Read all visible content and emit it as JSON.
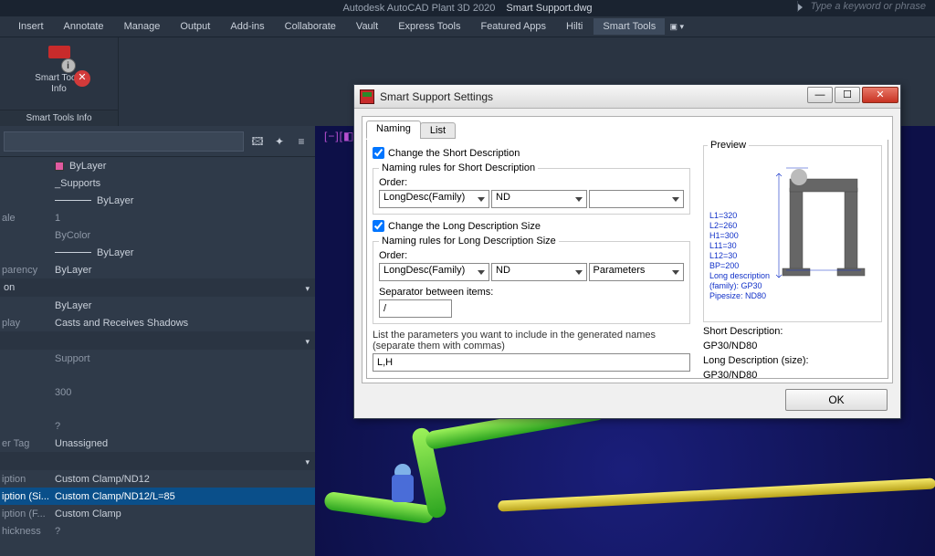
{
  "titlebar": {
    "app": "Autodesk AutoCAD Plant 3D 2020",
    "file": "Smart Support.dwg",
    "search_placeholder": "Type a keyword or phrase"
  },
  "menu": [
    "Insert",
    "Annotate",
    "Manage",
    "Output",
    "Add-ins",
    "Collaborate",
    "Vault",
    "Express Tools",
    "Featured Apps",
    "Hilti",
    "Smart Tools"
  ],
  "menu_active": 10,
  "ribbon": {
    "btn_label_1": "Smart Tools",
    "btn_label_2": "Info",
    "panel_title": "Smart Tools Info"
  },
  "viewport": {
    "corner": "[−][◧["
  },
  "props": {
    "color_label": "ByLayer",
    "layer": "_Supports",
    "linetype": "ByLayer",
    "scale_lbl": "ale",
    "scale": "1",
    "plotstyle": "ByColor",
    "lineweight": "ByLayer",
    "transp_lbl": "parency",
    "transp": "ByLayer",
    "sect_3d": "on",
    "material": "ByLayer",
    "disp_lbl": "play",
    "shadow": "Casts and Receives Shadows",
    "family": "Support",
    "h": "300",
    "unk": "?",
    "tag_lbl": "er Tag",
    "tag": "Unassigned",
    "d1_lbl": "iption",
    "d1": "Custom Clamp/ND12",
    "d2_lbl": "iption (Si...",
    "d2": "Custom Clamp/ND12/L=85",
    "d3_lbl": "iption (F...",
    "d3": "Custom Clamp",
    "thk_lbl": "hickness",
    "thk": "?"
  },
  "dialog": {
    "title": "Smart Support Settings",
    "tabs": [
      "Naming",
      "List"
    ],
    "chk_short": "Change the Short Description",
    "grp_short": "Naming rules for Short Description",
    "order_lbl": "Order:",
    "combo_long": "LongDesc(Family)",
    "combo_nd": "ND",
    "combo_empty": "",
    "chk_long": "Change the Long Description Size",
    "grp_long": "Naming rules for Long Description Size",
    "combo_params": "Parameters",
    "sep_lbl": "Separator between items:",
    "sep_val": "/",
    "params_hint": "List the parameters you want to include in the generated names (separate them with commas)",
    "params_val": "L,H",
    "preview_title": "Preview",
    "preview_lines": "L1=320\nL2=260\nH1=300\nL11=30\nL12=30\nBP=200\nLong description\n(family): GP30\nPipesize: ND80",
    "sd_lbl": "Short Description:",
    "sd_val": "GP30/ND80",
    "ld_lbl": "Long Description (size):",
    "ld_val": "GP30/ND80",
    "ok": "OK"
  }
}
